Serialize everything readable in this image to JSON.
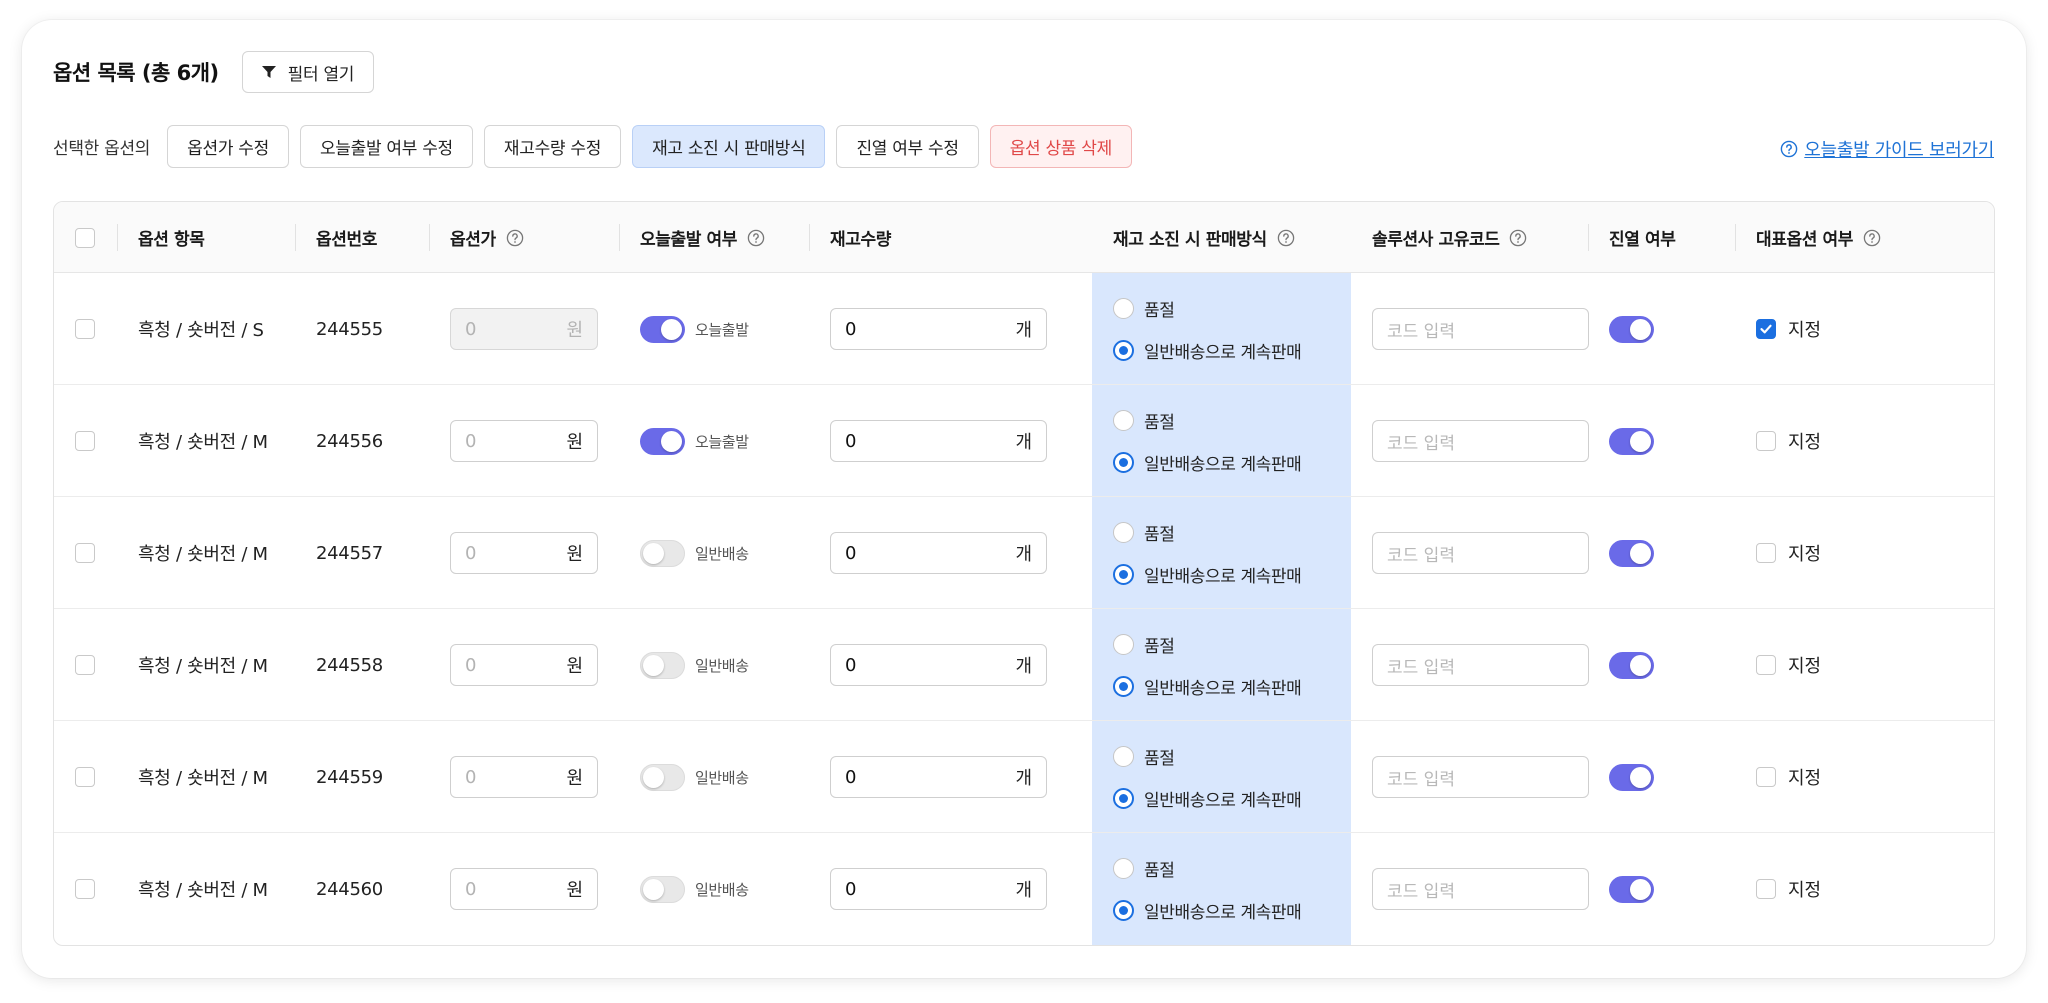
{
  "header": {
    "title": "옵션 목록 (총 6개)",
    "filter_label": "필터 열기"
  },
  "bulk": {
    "label": "선택한 옵션의",
    "buttons": [
      "옵션가 수정",
      "오늘출발 여부 수정",
      "재고수량 수정",
      "재고 소진 시 판매방식",
      "진열 여부 수정",
      "옵션 상품 삭제"
    ],
    "guide_link": "오늘출발 가이드 보러가기"
  },
  "table": {
    "columns": [
      "옵션 항목",
      "옵션번호",
      "옵션가",
      "오늘출발 여부",
      "재고수량",
      "재고 소진 시 판매방식",
      "솔루션사 고유코드",
      "진열 여부",
      "대표옵션 여부"
    ],
    "price_unit": "원",
    "stock_unit": "개",
    "code_placeholder": "코드 입력",
    "radio_soldout": "품절",
    "radio_continue": "일반배송으로 계속판매",
    "rep_label": "지정",
    "rows": [
      {
        "item": "흑청 / 숏버전 / S",
        "number": "244555",
        "price": "0",
        "today": true,
        "today_label": "오늘출발",
        "stock": "0",
        "display": true,
        "representative": true
      },
      {
        "item": "흑청 / 숏버전 / M",
        "number": "244556",
        "price": "0",
        "today": true,
        "today_label": "오늘출발",
        "stock": "0",
        "display": true,
        "representative": false
      },
      {
        "item": "흑청 / 숏버전 / M",
        "number": "244557",
        "price": "0",
        "today": false,
        "today_label": "일반배송",
        "stock": "0",
        "display": true,
        "representative": false
      },
      {
        "item": "흑청 / 숏버전 / M",
        "number": "244558",
        "price": "0",
        "today": false,
        "today_label": "일반배송",
        "stock": "0",
        "display": true,
        "representative": false
      },
      {
        "item": "흑청 / 숏버전 / M",
        "number": "244559",
        "price": "0",
        "today": false,
        "today_label": "일반배송",
        "stock": "0",
        "display": true,
        "representative": false
      },
      {
        "item": "흑청 / 숏버전 / M",
        "number": "244560",
        "price": "0",
        "today": false,
        "today_label": "일반배송",
        "stock": "0",
        "display": true,
        "representative": false
      }
    ]
  },
  "colors": {
    "primary": "#1b6fe0",
    "toggle_on": "#6a6ae8",
    "highlight": "#d9e7fd",
    "danger": "#e04848",
    "link": "#1f73d6"
  }
}
